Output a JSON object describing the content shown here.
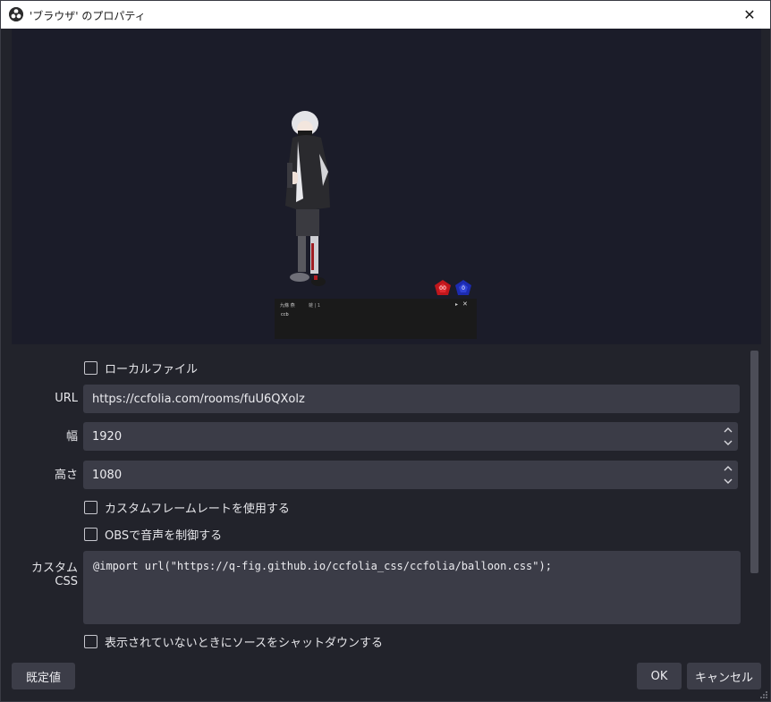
{
  "window": {
    "title": "'ブラウザ' のプロパティ",
    "close_label": "✕"
  },
  "preview": {
    "chat_header": "九條 燕",
    "chat_sub": "雑 | 1",
    "chat_arrow": "▸",
    "chat_close": "✕",
    "chat_text": "ccb",
    "dice_red_label": "00",
    "dice_blue_label": "0"
  },
  "form": {
    "local_file_label": "ローカルファイル",
    "url_label": "URL",
    "url_value": "https://ccfolia.com/rooms/fuU6QXolz",
    "width_label": "幅",
    "width_value": "1920",
    "height_label": "高さ",
    "height_value": "1080",
    "custom_fps_label": "カスタムフレームレートを使用する",
    "obs_audio_label": "OBSで音声を制御する",
    "custom_css_label": "カスタム CSS",
    "custom_css_value": "@import url(\"https://q-fig.github.io/ccfolia_css/ccfolia/balloon.css\");",
    "shutdown_label": "表示されていないときにソースをシャットダウンする"
  },
  "buttons": {
    "defaults": "既定値",
    "ok": "OK",
    "cancel": "キャンセル"
  },
  "colors": {
    "background": "#22232b",
    "field": "#3b3c47",
    "preview": "#1b1c29",
    "dice_red": "#c0161c",
    "dice_blue": "#1c2bb0"
  }
}
